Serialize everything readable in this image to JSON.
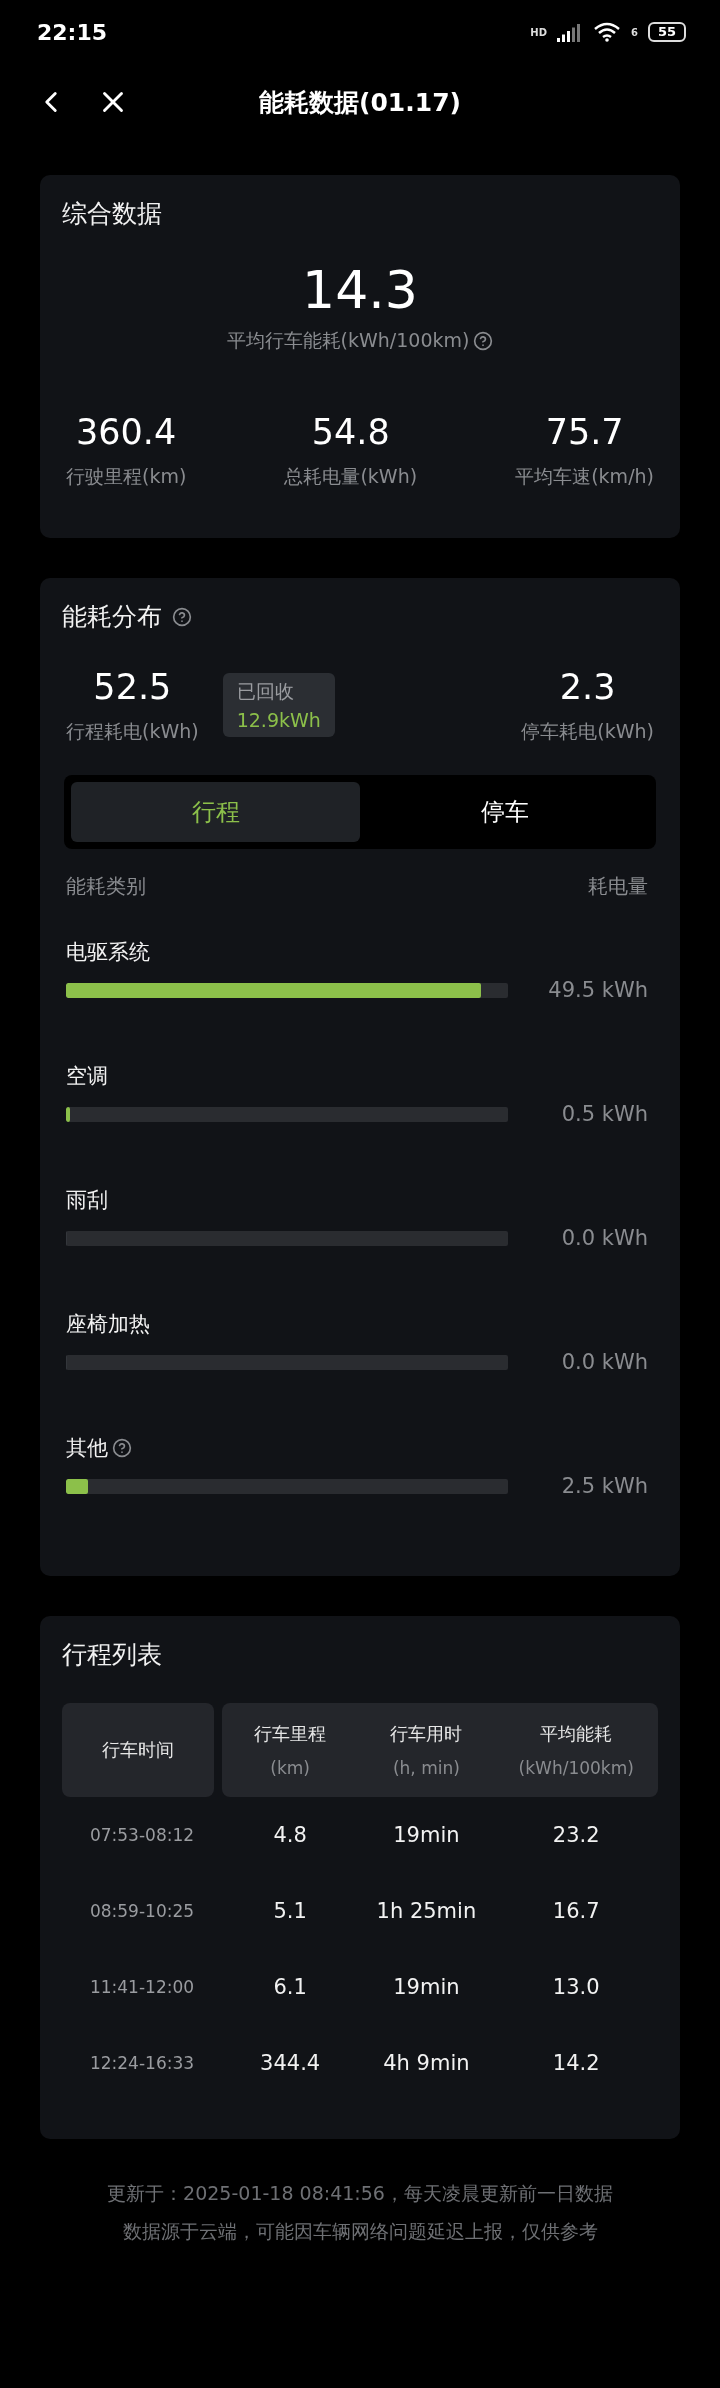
{
  "status_bar": {
    "time": "22:15",
    "network": "HD",
    "wifi_badge": "6",
    "battery": "55"
  },
  "nav": {
    "title": "能耗数据(01.17)"
  },
  "summary": {
    "title": "综合数据",
    "main_value": "14.3",
    "main_label": "平均行车能耗(kWh/100km)",
    "stats": [
      {
        "value": "360.4",
        "label": "行驶里程(km)"
      },
      {
        "value": "54.8",
        "label": "总耗电量(kWh)"
      },
      {
        "value": "75.7",
        "label": "平均车速(km/h)"
      }
    ]
  },
  "distribution": {
    "title": "能耗分布",
    "trip": {
      "value": "52.5",
      "label": "行程耗电(kWh)"
    },
    "recovered": {
      "label": "已回收",
      "value": "12.9kWh"
    },
    "parking": {
      "value": "2.3",
      "label": "停车耗电(kWh)"
    },
    "tabs": [
      {
        "label": "行程",
        "selected": true
      },
      {
        "label": "停车",
        "selected": false
      }
    ],
    "column_left": "能耗类别",
    "column_right": "耗电量",
    "categories": [
      {
        "name": "电驱系统",
        "help": false,
        "level": 0.94,
        "reading": "49.5 kWh"
      },
      {
        "name": "空调",
        "help": false,
        "level": 0.01,
        "reading": "0.5 kWh"
      },
      {
        "name": "雨刮",
        "help": false,
        "level": 0,
        "reading": "0.0 kWh"
      },
      {
        "name": "座椅加热",
        "help": false,
        "level": 0,
        "reading": "0.0 kWh"
      },
      {
        "name": "其他",
        "help": true,
        "level": 0.05,
        "reading": "2.5 kWh"
      }
    ]
  },
  "trips": {
    "title": "行程列表",
    "columns": [
      {
        "label": "行车时间"
      },
      {
        "label": "行车里程",
        "unit": "(km)"
      },
      {
        "label": "行车用时",
        "unit": "(h, min)"
      },
      {
        "label": "平均能耗",
        "unit": "(kWh/100km)"
      }
    ],
    "rows": [
      [
        "07:53-08:12",
        "4.8",
        "19min",
        "23.2"
      ],
      [
        "08:59-10:25",
        "5.1",
        "1h 25min",
        "16.7"
      ],
      [
        "11:41-12:00",
        "6.1",
        "19min",
        "13.0"
      ],
      [
        "12:24-16:33",
        "344.4",
        "4h 9min",
        "14.2"
      ]
    ]
  },
  "footer": [
    "更新于：2025-01-18 08:41:56，每天凌晨更新前一日数据",
    "数据源于云端，可能因车辆网络问题延迟上报，仅供参考"
  ]
}
